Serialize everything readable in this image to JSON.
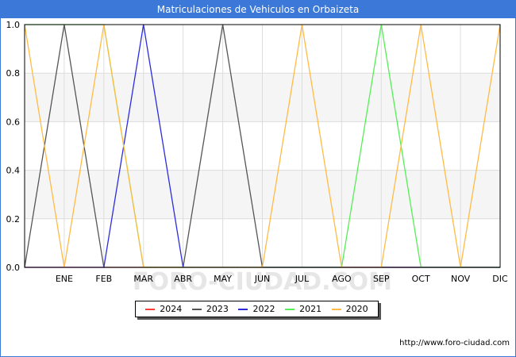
{
  "title": "Matriculaciones de Vehiculos en Orbaizeta",
  "footer_url": "http://www.foro-ciudad.com",
  "watermark": "FORO-CIUDAD.COM",
  "chart_data": {
    "type": "line",
    "x": [
      "",
      "ENE",
      "FEB",
      "MAR",
      "ABR",
      "MAY",
      "JUN",
      "JUL",
      "AGO",
      "SEP",
      "OCT",
      "NOV",
      "DIC"
    ],
    "y_ticks": [
      "0.0",
      "0.2",
      "0.4",
      "0.6",
      "0.8",
      "1.0"
    ],
    "ylim": [
      0,
      1
    ],
    "grid": true,
    "legend_position": "bottom",
    "series": [
      {
        "name": "2024",
        "color": "#ff3b3b",
        "values": [
          0,
          0,
          0,
          0,
          0,
          0,
          0,
          0,
          0,
          0,
          0,
          0,
          0
        ]
      },
      {
        "name": "2023",
        "color": "#555555",
        "values": [
          0,
          1,
          0,
          0,
          0,
          1,
          0,
          0,
          0,
          0,
          0,
          0,
          0
        ]
      },
      {
        "name": "2022",
        "color": "#2c2cdf",
        "values": [
          0,
          0,
          0,
          1,
          0,
          0,
          0,
          0,
          0,
          0,
          0,
          0,
          0
        ]
      },
      {
        "name": "2021",
        "color": "#55ee55",
        "values": [
          1,
          1,
          1,
          0,
          0,
          0,
          0,
          0,
          0,
          1,
          0,
          0,
          0
        ]
      },
      {
        "name": "2020",
        "color": "#ffbb44",
        "values": [
          1,
          0,
          1,
          0,
          0,
          0,
          0,
          1,
          0,
          0,
          1,
          0,
          1
        ]
      }
    ]
  }
}
